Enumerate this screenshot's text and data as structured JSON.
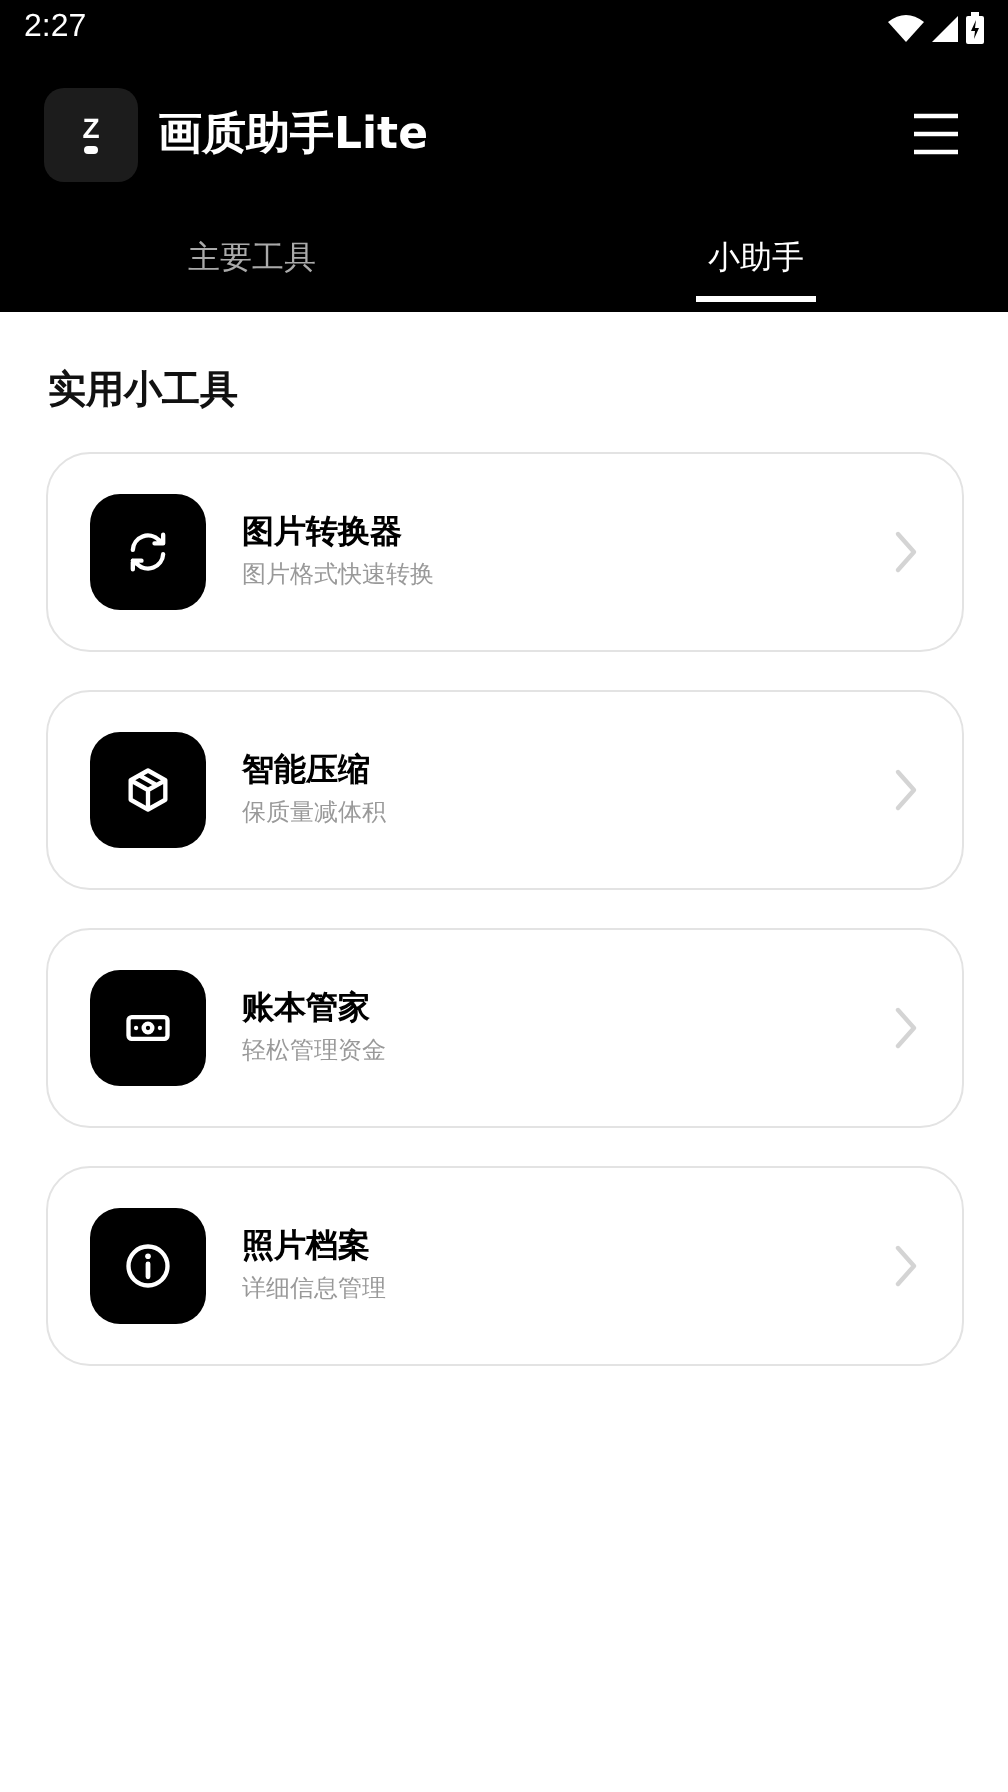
{
  "status_bar": {
    "time": "2:27"
  },
  "app_bar": {
    "logo_text": "Z",
    "title": "画质助手Lite"
  },
  "tabs": [
    {
      "label": "主要工具",
      "selected": false
    },
    {
      "label": "小助手",
      "selected": true
    }
  ],
  "section_title": "实用小工具",
  "tools": [
    {
      "kind": "convert",
      "title": "图片转换器",
      "subtitle": "图片格式快速转换"
    },
    {
      "kind": "compress",
      "title": "智能压缩",
      "subtitle": "保质量减体积"
    },
    {
      "kind": "money",
      "title": "账本管家",
      "subtitle": "轻松管理资金"
    },
    {
      "kind": "info",
      "title": "照片档案",
      "subtitle": "详细信息管理"
    }
  ]
}
